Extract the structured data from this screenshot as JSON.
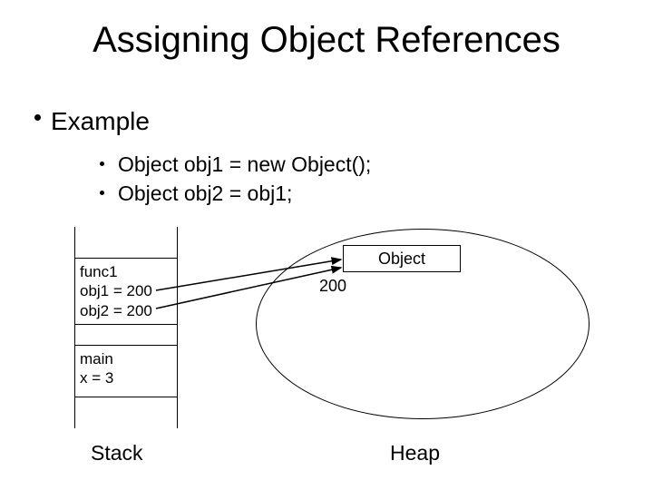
{
  "title": "Assigning Object References",
  "bullets": {
    "l1": "Example",
    "l2a": "Object obj1 = new Object();",
    "l2b": "Object obj2 = obj1;"
  },
  "stack": {
    "func1": {
      "name": "func1",
      "obj1_line": "obj1 = 200",
      "obj2_line": "obj2 = 200"
    },
    "main": {
      "name": "main",
      "x_line": "x = 3"
    },
    "label": "Stack"
  },
  "heap": {
    "object_label": "Object",
    "address": "200",
    "label": "Heap"
  }
}
